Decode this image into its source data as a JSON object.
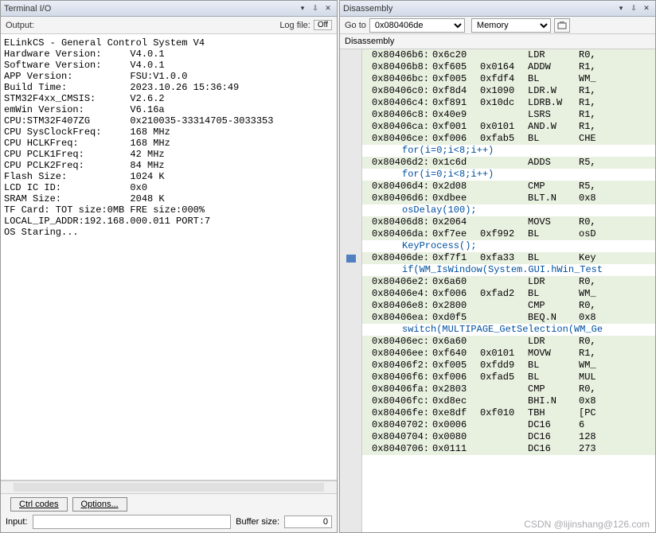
{
  "terminal": {
    "title": "Terminal I/O",
    "output_label": "Output:",
    "logfile_label": "Log file:",
    "logfile_state": "Off",
    "input_label": "Input:",
    "ctrl_codes_btn": "Ctrl codes",
    "options_btn": "Options...",
    "buffer_size_label": "Buffer size:",
    "buffer_size_value": "0",
    "lines": [
      "ELinkCS - General Control System V4",
      "Hardware Version:     V4.0.1",
      "Software Version:     V4.0.1",
      "APP Version:          FSU:V1.0.0",
      "Build Time:           2023.10.26 15:36:49",
      "STM32F4xx_CMSIS:      V2.6.2",
      "emWin Version:        V6.16a",
      "CPU:STM32F407ZG       0x210035-33314705-3033353",
      "CPU SysClockFreq:     168 MHz",
      "CPU HCLKFreq:         168 MHz",
      "CPU PCLK1Freq:        42 MHz",
      "CPU PCLK2Freq:        84 MHz",
      "Flash Size:           1024 K",
      "LCD IC ID:            0x0",
      "SRAM Size:            2048 K",
      "TF Card: TOT size:0MB FRE size:000%",
      "LOCAL_IP_ADDR:192.168.000.011 PORT:7",
      "OS Staring..."
    ]
  },
  "disasm": {
    "title": "Disassembly",
    "goto_label": "Go to",
    "goto_value": "0x080406de",
    "view_mode": "Memory",
    "header": "Disassembly",
    "cursor_addr": "0x80406de",
    "rows": [
      {
        "t": "code",
        "addr": "0x80406b6:",
        "b1": "0x6c20",
        "b2": "",
        "mn": "LDR",
        "op": "R0,"
      },
      {
        "t": "code",
        "addr": "0x80406b8:",
        "b1": "0xf605",
        "b2": "0x0164",
        "mn": "ADDW",
        "op": "R1,"
      },
      {
        "t": "code",
        "addr": "0x80406bc:",
        "b1": "0xf005",
        "b2": "0xfdf4",
        "mn": "BL",
        "op": "WM_"
      },
      {
        "t": "code",
        "addr": "0x80406c0:",
        "b1": "0xf8d4",
        "b2": "0x1090",
        "mn": "LDR.W",
        "op": "R1,"
      },
      {
        "t": "code",
        "addr": "0x80406c4:",
        "b1": "0xf891",
        "b2": "0x10dc",
        "mn": "LDRB.W",
        "op": "R1,"
      },
      {
        "t": "code",
        "addr": "0x80406c8:",
        "b1": "0x40e9",
        "b2": "",
        "mn": "LSRS",
        "op": "R1,"
      },
      {
        "t": "code",
        "addr": "0x80406ca:",
        "b1": "0xf001",
        "b2": "0x0101",
        "mn": "AND.W",
        "op": "R1,"
      },
      {
        "t": "code",
        "addr": "0x80406ce:",
        "b1": "0xf006",
        "b2": "0xfab5",
        "mn": "BL",
        "op": "CHE"
      },
      {
        "t": "src",
        "text": "for(i=0;i<8;i++)"
      },
      {
        "t": "code",
        "addr": "0x80406d2:",
        "b1": "0x1c6d",
        "b2": "",
        "mn": "ADDS",
        "op": "R5,"
      },
      {
        "t": "src",
        "text": "for(i=0;i<8;i++)"
      },
      {
        "t": "code",
        "addr": "0x80406d4:",
        "b1": "0x2d08",
        "b2": "",
        "mn": "CMP",
        "op": "R5,"
      },
      {
        "t": "code",
        "addr": "0x80406d6:",
        "b1": "0xdbee",
        "b2": "",
        "mn": "BLT.N",
        "op": "0x8"
      },
      {
        "t": "src",
        "text": "osDelay(100);"
      },
      {
        "t": "code",
        "addr": "0x80406d8:",
        "b1": "0x2064",
        "b2": "",
        "mn": "MOVS",
        "op": "R0,"
      },
      {
        "t": "code",
        "addr": "0x80406da:",
        "b1": "0xf7ee",
        "b2": "0xf992",
        "mn": "BL",
        "op": "osD"
      },
      {
        "t": "src",
        "text": "KeyProcess();"
      },
      {
        "t": "code",
        "addr": "0x80406de:",
        "b1": "0xf7f1",
        "b2": "0xfa33",
        "mn": "BL",
        "op": "Key"
      },
      {
        "t": "src",
        "text": "if(WM_IsWindow(System.GUI.hWin_Test"
      },
      {
        "t": "code",
        "addr": "0x80406e2:",
        "b1": "0x6a60",
        "b2": "",
        "mn": "LDR",
        "op": "R0,"
      },
      {
        "t": "code",
        "addr": "0x80406e4:",
        "b1": "0xf006",
        "b2": "0xfad2",
        "mn": "BL",
        "op": "WM_"
      },
      {
        "t": "code",
        "addr": "0x80406e8:",
        "b1": "0x2800",
        "b2": "",
        "mn": "CMP",
        "op": "R0,"
      },
      {
        "t": "code",
        "addr": "0x80406ea:",
        "b1": "0xd0f5",
        "b2": "",
        "mn": "BEQ.N",
        "op": "0x8"
      },
      {
        "t": "src",
        "text": "switch(MULTIPAGE_GetSelection(WM_Ge"
      },
      {
        "t": "code",
        "addr": "0x80406ec:",
        "b1": "0x6a60",
        "b2": "",
        "mn": "LDR",
        "op": "R0,"
      },
      {
        "t": "code",
        "addr": "0x80406ee:",
        "b1": "0xf640",
        "b2": "0x0101",
        "mn": "MOVW",
        "op": "R1,"
      },
      {
        "t": "code",
        "addr": "0x80406f2:",
        "b1": "0xf005",
        "b2": "0xfdd9",
        "mn": "BL",
        "op": "WM_"
      },
      {
        "t": "code",
        "addr": "0x80406f6:",
        "b1": "0xf006",
        "b2": "0xfad5",
        "mn": "BL",
        "op": "MUL"
      },
      {
        "t": "code",
        "addr": "0x80406fa:",
        "b1": "0x2803",
        "b2": "",
        "mn": "CMP",
        "op": "R0,"
      },
      {
        "t": "code",
        "addr": "0x80406fc:",
        "b1": "0xd8ec",
        "b2": "",
        "mn": "BHI.N",
        "op": "0x8"
      },
      {
        "t": "code",
        "addr": "0x80406fe:",
        "b1": "0xe8df",
        "b2": "0xf010",
        "mn": "TBH",
        "op": "[PC"
      },
      {
        "t": "code",
        "addr": "0x8040702:",
        "b1": "0x0006",
        "b2": "",
        "mn": "DC16",
        "op": "6"
      },
      {
        "t": "code",
        "addr": "0x8040704:",
        "b1": "0x0080",
        "b2": "",
        "mn": "DC16",
        "op": "128"
      },
      {
        "t": "code",
        "addr": "0x8040706:",
        "b1": "0x0111",
        "b2": "",
        "mn": "DC16",
        "op": "273"
      }
    ]
  },
  "watermark": "CSDN @lijinshang@126.com"
}
